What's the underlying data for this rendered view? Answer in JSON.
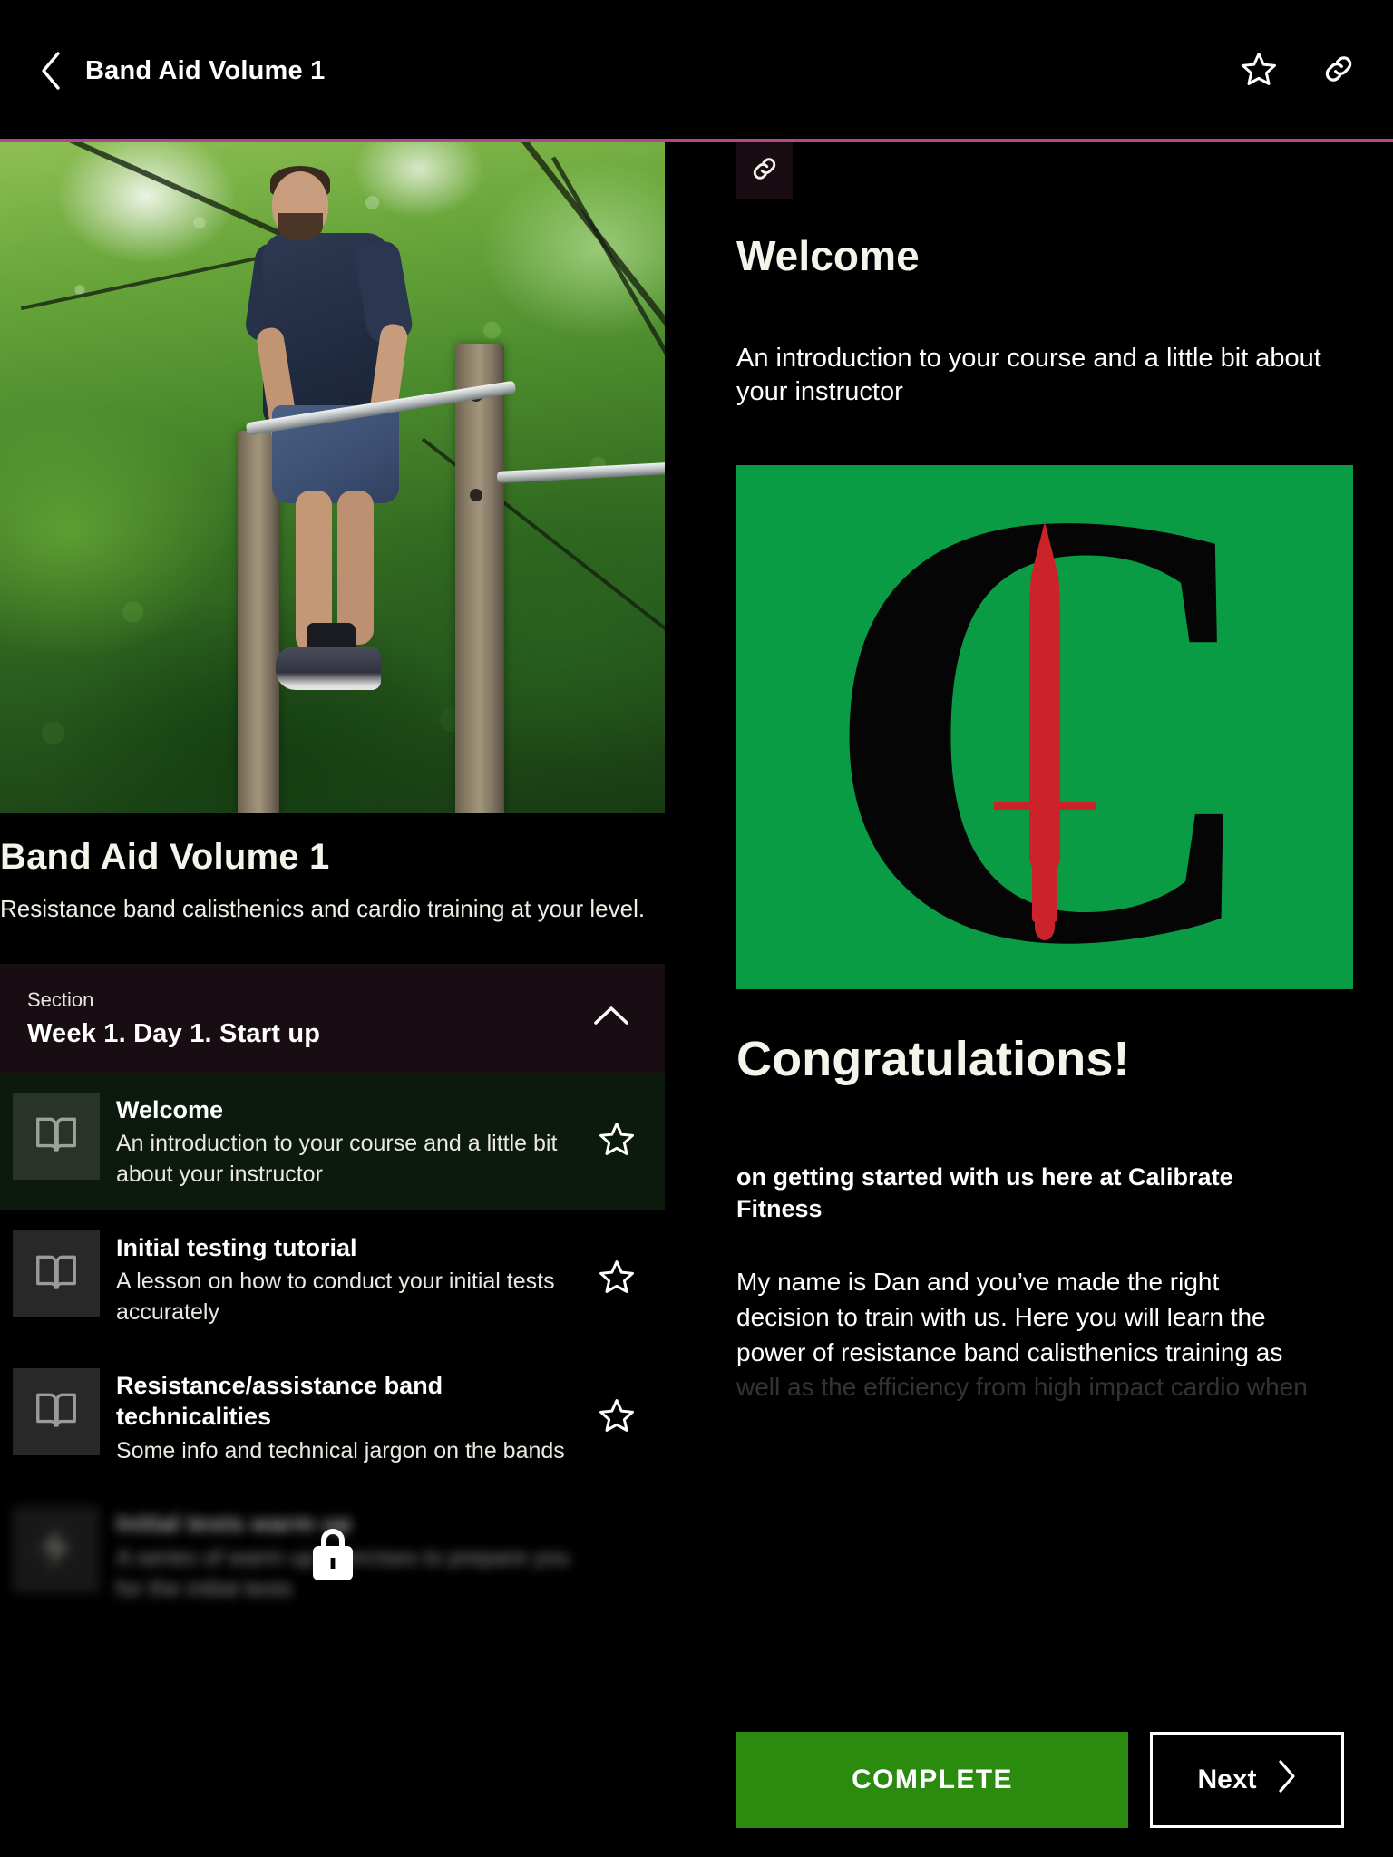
{
  "appbar": {
    "back_icon": "chevron-left-icon",
    "title": "Band Aid Volume 1",
    "favorite_icon": "star-outline-icon",
    "share_icon": "link-icon"
  },
  "accent_color": "#b3478c",
  "left_panel": {
    "hero_alt": "Man performing a muscle-up on an outdoor pull-up bar in a green forest",
    "course_title": "Band Aid Volume 1",
    "course_subtitle": "Resistance band calisthenics and cardio training at your level.",
    "section": {
      "eyebrow": "Section",
      "name": "Week 1. Day 1. Start up",
      "toggle_icon": "chevron-up-icon",
      "expanded": true
    },
    "lessons": [
      {
        "title": "Welcome",
        "description": "An introduction to your course and a little bit about your instructor",
        "thumb_icon": "book-icon",
        "star_icon": "star-outline-icon",
        "active": true,
        "locked": false
      },
      {
        "title": "Initial testing tutorial",
        "description": "A lesson on how to conduct your initial tests accurately",
        "thumb_icon": "book-icon",
        "star_icon": "star-outline-icon",
        "active": false,
        "locked": false
      },
      {
        "title": "Resistance/assistance band technicalities",
        "description": "Some info and technical jargon on the bands",
        "thumb_icon": "book-icon",
        "star_icon": "star-outline-icon",
        "active": false,
        "locked": false
      },
      {
        "title": "Initial tests warm up",
        "description": "A series of warm up exercises to prepare you for the initial tests",
        "thumb_icon": "lightning-bolt-icon",
        "star_icon": "star-outline-icon",
        "active": false,
        "locked": true,
        "lock_icon": "lock-icon"
      }
    ]
  },
  "right_panel": {
    "link_chip_icon": "link-icon",
    "heading": "Welcome",
    "intro": "An introduction to your course and a little bit about your instructor",
    "logo": {
      "background_color": "#0a9c44",
      "letter": "C",
      "dagger_color": "#cc2229",
      "alt": "Calibrate Fitness logo: black letter C with a red dagger"
    },
    "congrats_heading": "Congratulations!",
    "congrats_lede": "on getting started with us here at Calibrate Fitness",
    "body_line_1": "My name is Dan and you’ve made the right",
    "body_line_2": "decision to train with us. Here you will learn the",
    "body_line_3": "power of resistance band calisthenics training as",
    "body_line_4": "well as the efficiency from high impact cardio when"
  },
  "action_bar": {
    "complete_label": "COMPLETE",
    "complete_color": "#2a8b0e",
    "next_label": "Next",
    "next_icon": "chevron-right-icon"
  }
}
